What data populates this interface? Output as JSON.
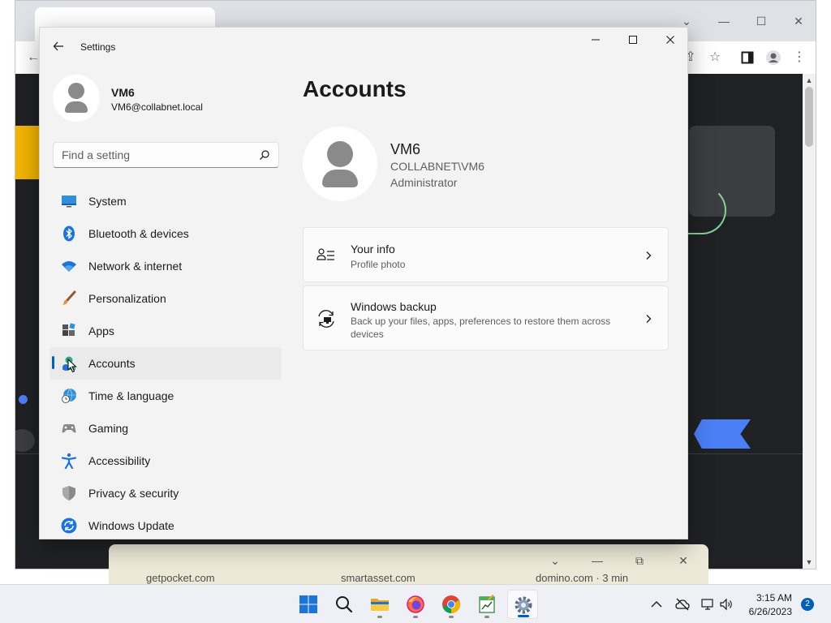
{
  "browser": {
    "background_links": [
      "getpocket.com",
      "smartasset.com",
      "domino.com · 3 min"
    ]
  },
  "settings": {
    "app_title": "Settings",
    "profile": {
      "name": "VM6",
      "email": "VM6@collabnet.local"
    },
    "search": {
      "placeholder": "Find a setting"
    },
    "nav": [
      {
        "label": "System",
        "icon": "system-icon"
      },
      {
        "label": "Bluetooth & devices",
        "icon": "bluetooth-icon"
      },
      {
        "label": "Network & internet",
        "icon": "wifi-icon"
      },
      {
        "label": "Personalization",
        "icon": "brush-icon"
      },
      {
        "label": "Apps",
        "icon": "apps-icon"
      },
      {
        "label": "Accounts",
        "icon": "accounts-icon",
        "selected": true
      },
      {
        "label": "Time & language",
        "icon": "globe-clock-icon"
      },
      {
        "label": "Gaming",
        "icon": "gamepad-icon"
      },
      {
        "label": "Accessibility",
        "icon": "accessibility-icon"
      },
      {
        "label": "Privacy & security",
        "icon": "shield-icon"
      },
      {
        "label": "Windows Update",
        "icon": "update-icon"
      }
    ],
    "page_title": "Accounts",
    "account": {
      "name": "VM6",
      "domain": "COLLABNET\\VM6",
      "role": "Administrator"
    },
    "cards": [
      {
        "title": "Your info",
        "subtitle": "Profile photo",
        "icon": "person-info-icon"
      },
      {
        "title": "Windows backup",
        "subtitle": "Back up your files, apps, preferences to restore them across devices",
        "icon": "backup-icon"
      }
    ]
  },
  "taskbar": {
    "apps": [
      "start",
      "search",
      "file-explorer",
      "firefox",
      "chrome",
      "notepad-app",
      "settings"
    ],
    "time": "3:15 AM",
    "date": "6/26/2023",
    "notification_count": "2"
  },
  "colors": {
    "accent": "#005fb8",
    "window_bg": "#f3f3f3",
    "card_bg": "#fbfbfb"
  }
}
